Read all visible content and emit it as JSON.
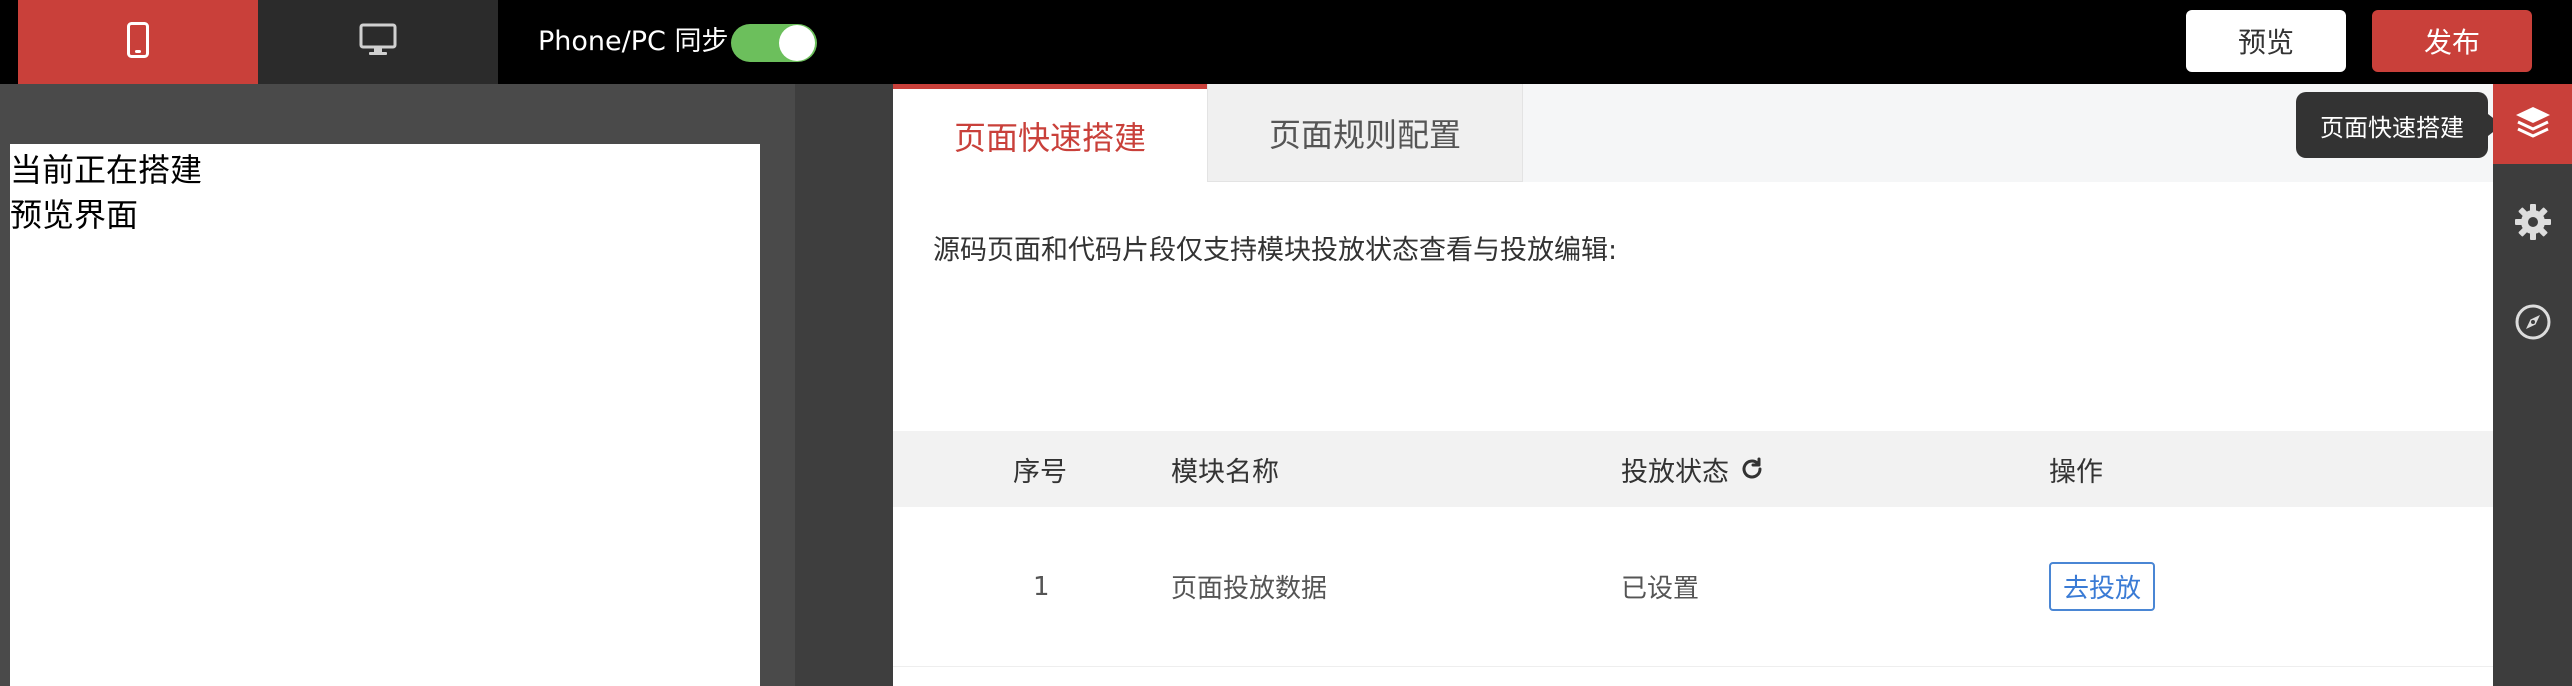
{
  "topbar": {
    "device_phone_icon": "mobile-phone-icon",
    "device_pc_icon": "desktop-monitor-icon",
    "sync_label": "Phone/PC 同步",
    "sync_enabled": true,
    "preview_label": "预览",
    "publish_label": "发布"
  },
  "preview": {
    "line1": "当前正在搭建",
    "line2": "预览界面"
  },
  "tabs": [
    {
      "label": "页面快速搭建",
      "active": true
    },
    {
      "label": "页面规则配置",
      "active": false
    }
  ],
  "main": {
    "description": "源码页面和代码片段仅支持模块投放状态查看与投放编辑:"
  },
  "table": {
    "headers": [
      "序号",
      "模块名称",
      "投放状态",
      "操作"
    ],
    "rows": [
      {
        "index": "1",
        "name": "页面投放数据",
        "status": "已设置",
        "action": "去投放"
      }
    ]
  },
  "sidebar": {
    "tooltip": "页面快速搭建",
    "items": [
      "layers-icon",
      "gear-icon",
      "compass-icon"
    ]
  },
  "colors": {
    "accent": "#c9403a",
    "toggle_on": "#6cbf5c",
    "link_blue": "#3a7bd5"
  }
}
